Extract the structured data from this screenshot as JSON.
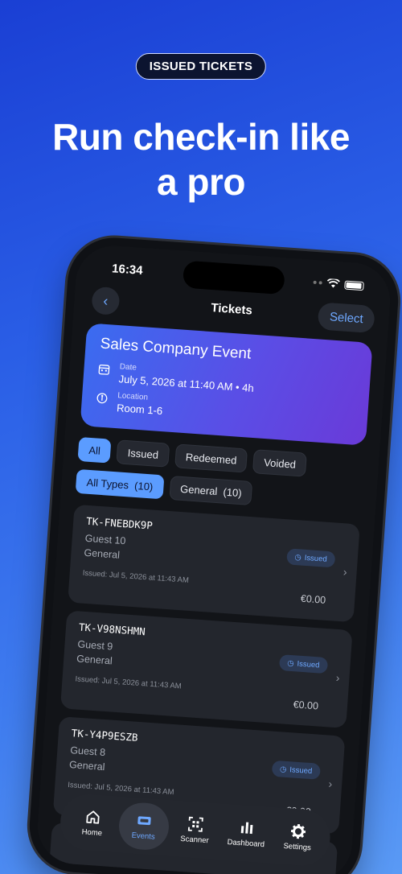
{
  "marketing": {
    "pill": "ISSUED TICKETS",
    "headline_line1": "Run check-in like",
    "headline_line2": "a pro"
  },
  "status": {
    "time": "16:34"
  },
  "nav": {
    "title": "Tickets",
    "select_label": "Select"
  },
  "event": {
    "name": "Sales Company Event",
    "date_label": "Date",
    "date_value": "July 5, 2026 at 11:40 AM • 4h",
    "location_label": "Location",
    "location_value": "Room 1-6"
  },
  "status_filters": [
    {
      "label": "All",
      "active": true
    },
    {
      "label": "Issued",
      "active": false
    },
    {
      "label": "Redeemed",
      "active": false
    },
    {
      "label": "Voided",
      "active": false
    }
  ],
  "type_filters": [
    {
      "label": "All Types",
      "count": "(10)",
      "active": true
    },
    {
      "label": "General",
      "count": "(10)",
      "active": false
    }
  ],
  "tickets": [
    {
      "code": "TK-FNEBDK9P",
      "guest": "Guest 10",
      "type": "General",
      "status": "Issued",
      "issued": "Issued: Jul 5, 2026 at 11:43 AM",
      "price": "€0.00"
    },
    {
      "code": "TK-V98NSHMN",
      "guest": "Guest 9",
      "type": "General",
      "status": "Issued",
      "issued": "Issued: Jul 5, 2026 at 11:43 AM",
      "price": "€0.00"
    },
    {
      "code": "TK-Y4P9ESZB",
      "guest": "Guest 8",
      "type": "General",
      "status": "Issued",
      "issued": "Issued: Jul 5, 2026 at 11:43 AM",
      "price": "€0.00"
    }
  ],
  "tabs": [
    {
      "label": "Home",
      "icon": "house-icon",
      "active": false
    },
    {
      "label": "Events",
      "icon": "ticket-icon",
      "active": true
    },
    {
      "label": "Scanner",
      "icon": "qr-code-icon",
      "active": false
    },
    {
      "label": "Dashboard",
      "icon": "bar-chart-icon",
      "active": false
    },
    {
      "label": "Settings",
      "icon": "gear-icon",
      "active": false
    }
  ],
  "colors": {
    "background_start": "#1a3fd4",
    "background_end": "#5a9af5",
    "accent": "#6ea8ff",
    "active_chip": "#5b9cff",
    "card_gradient_start": "#3a6cf0",
    "card_gradient_end": "#6a3ad8"
  }
}
